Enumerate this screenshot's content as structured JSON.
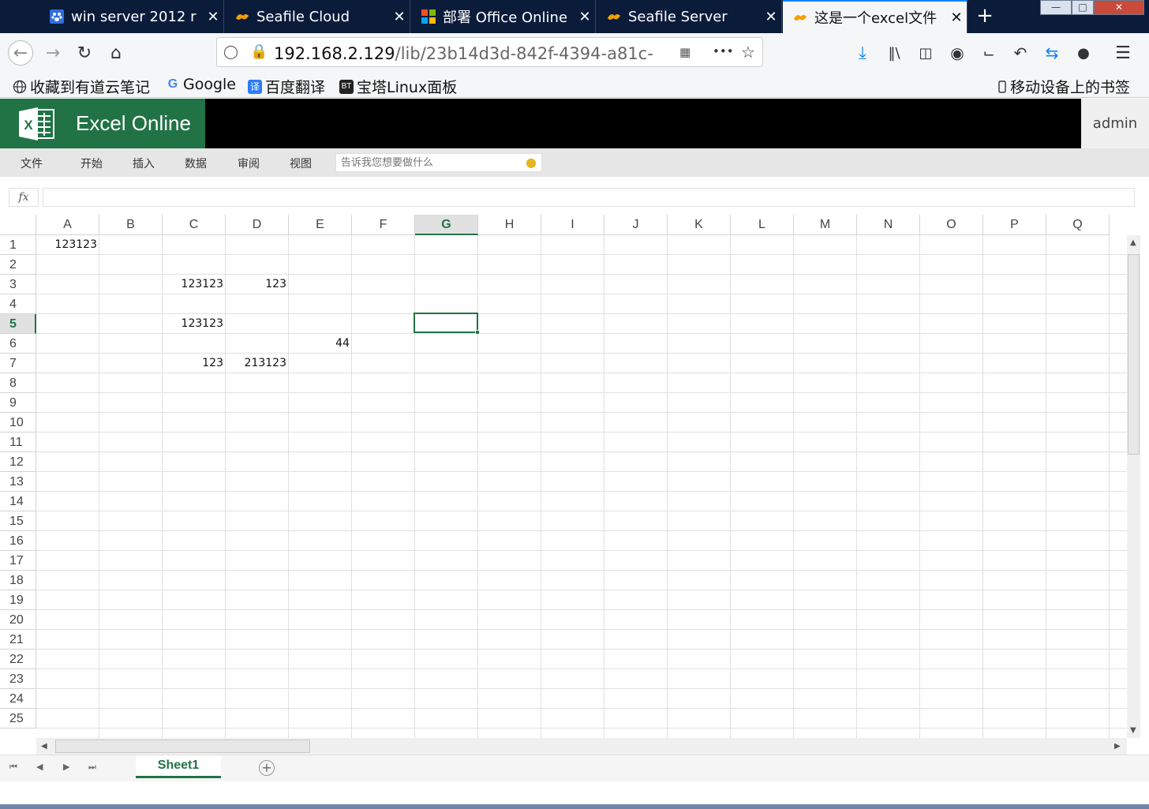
{
  "browser": {
    "tabs": [
      {
        "title": "win server 2012 r",
        "favicon": "paw-icon",
        "active": false
      },
      {
        "title": "Seafile Cloud",
        "favicon": "seafile-icon",
        "active": false
      },
      {
        "title": "部署 Office Online",
        "favicon": "microsoft-icon",
        "active": false
      },
      {
        "title": "Seafile Server",
        "favicon": "seafile-icon",
        "active": false
      },
      {
        "title": "这是一个excel文件",
        "favicon": "seafile-icon",
        "active": true
      }
    ],
    "close_glyph": "✕",
    "new_tab": "+",
    "url_host": "192.168.2.129",
    "url_path": "/lib/23b14d3d-842f-4394-a81c-",
    "more_glyph": "•••",
    "bookmarks": [
      {
        "label": "收藏到有道云笔记",
        "icon": "globe-icon"
      },
      {
        "label": "Google",
        "icon": "google-icon"
      },
      {
        "label": "百度翻译",
        "icon": "translate-icon"
      },
      {
        "label": "宝塔Linux面板",
        "icon": "bt-icon"
      }
    ],
    "mobile_bookmarks": "移动设备上的书签"
  },
  "excel": {
    "brand": "Excel Online",
    "user": "admin",
    "menus": [
      "文件",
      "开始",
      "插入",
      "数据",
      "审阅",
      "视图"
    ],
    "tell_me_placeholder": "告诉我您想要做什么",
    "fx_label": "fx",
    "formula_value": "",
    "columns": [
      "A",
      "B",
      "C",
      "D",
      "E",
      "F",
      "G",
      "H",
      "I",
      "J",
      "K",
      "L",
      "M",
      "N",
      "O",
      "P",
      "Q"
    ],
    "rows": [
      "1",
      "2",
      "3",
      "4",
      "5",
      "6",
      "7",
      "8",
      "9",
      "10",
      "11",
      "12",
      "13",
      "14",
      "15",
      "16",
      "17",
      "18",
      "19",
      "20",
      "21",
      "22",
      "23",
      "24",
      "25"
    ],
    "selected_col": "G",
    "selected_row": "5",
    "cells": [
      {
        "ref": "A1",
        "col": 0,
        "row": 0,
        "value": "123123"
      },
      {
        "ref": "C3",
        "col": 2,
        "row": 2,
        "value": "123123"
      },
      {
        "ref": "D3",
        "col": 3,
        "row": 2,
        "value": "123"
      },
      {
        "ref": "C5",
        "col": 2,
        "row": 4,
        "value": "123123"
      },
      {
        "ref": "E6",
        "col": 4,
        "row": 5,
        "value": "44"
      },
      {
        "ref": "C7",
        "col": 2,
        "row": 6,
        "value": "123"
      },
      {
        "ref": "D7",
        "col": 3,
        "row": 6,
        "value": "213123"
      }
    ],
    "sheets": [
      "Sheet1"
    ],
    "add_sheet": "+"
  },
  "colors": {
    "excel_green": "#217346",
    "tabbar": "#0b1b3a"
  }
}
